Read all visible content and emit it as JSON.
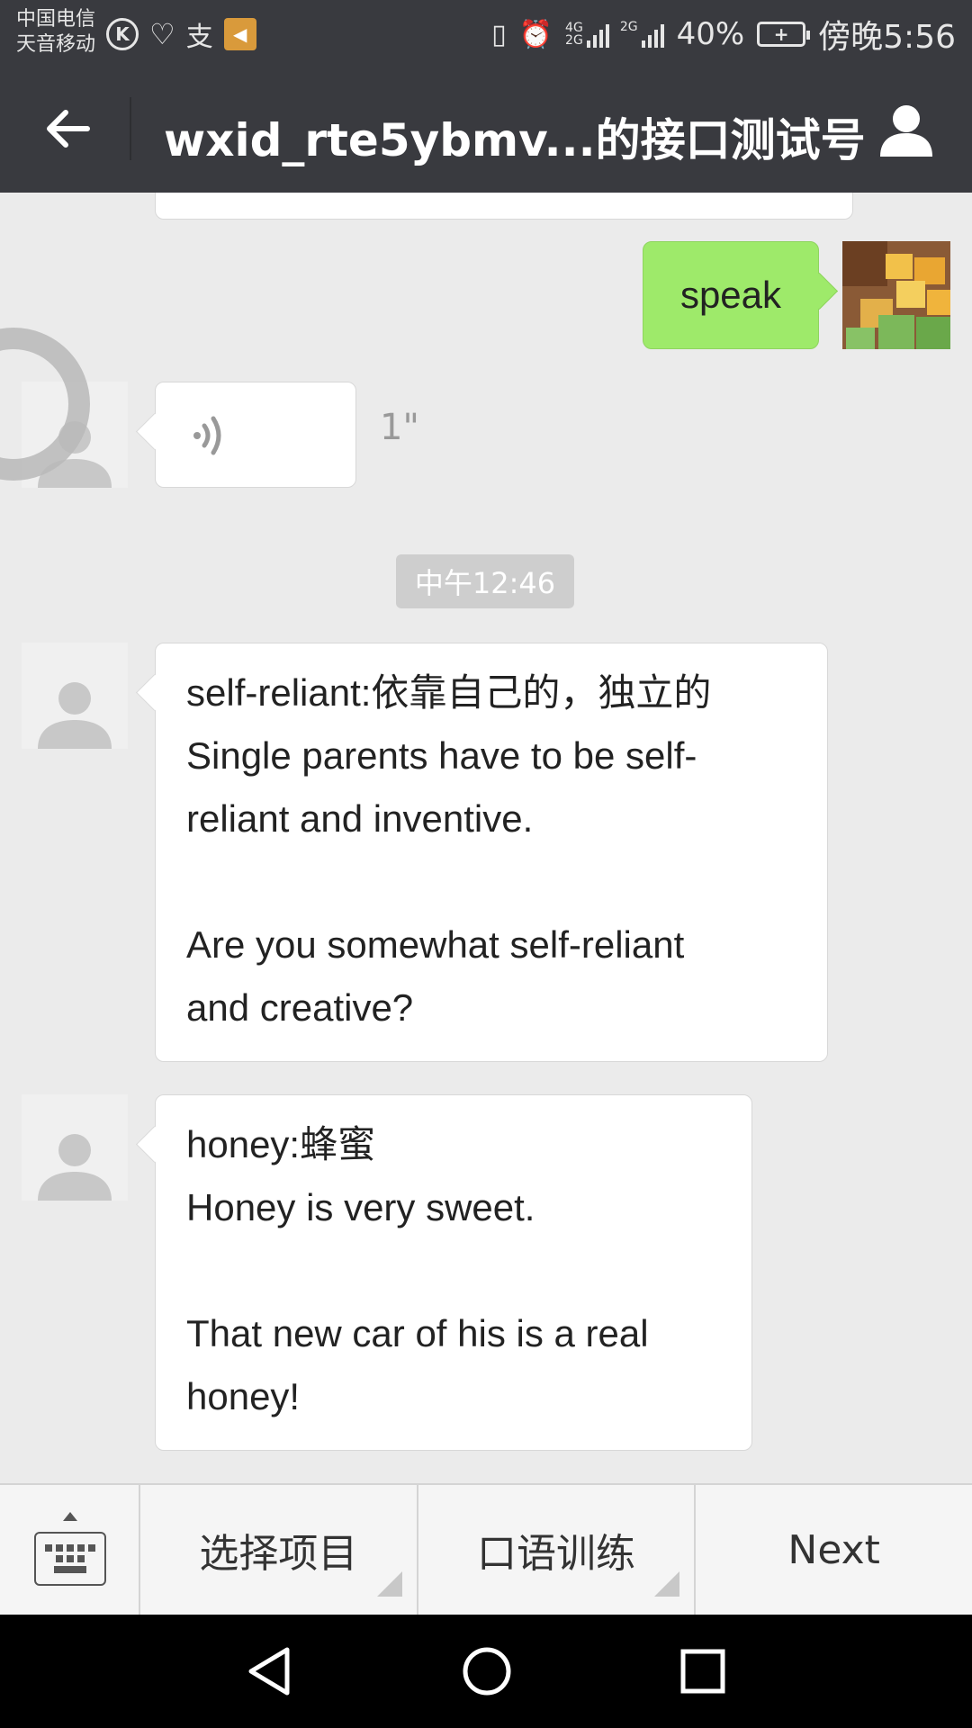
{
  "status_bar": {
    "carrier_line1": "中国电信",
    "carrier_line2": "天音移动",
    "k_badge": "K",
    "pay_label": "支",
    "net_4g": "4G",
    "net_2g": "2G",
    "net_2g_b": "2G",
    "battery_percent": "40%",
    "time": "傍晚5:56",
    "icons": [
      "k-icon",
      "heart-icon",
      "pay-icon",
      "sound-icon",
      "vibrate-icon",
      "alarm-icon",
      "signal-icon",
      "battery-icon"
    ]
  },
  "header": {
    "title": "wxid_rte5ybmv...的接口测试号",
    "back_icon": "arrow-left-icon",
    "profile_icon": "person-icon"
  },
  "chat": {
    "sent": {
      "text": "speak"
    },
    "voice": {
      "duration": "1\""
    },
    "time_separator": "中午12:46",
    "messages": [
      {
        "lines": [
          "self-reliant:依靠自己的，独立的",
          "Single parents have to be self-",
          "reliant and inventive.",
          "",
          "Are you somewhat self-reliant",
          "and creative?"
        ]
      },
      {
        "lines": [
          "honey:蜂蜜",
          "Honey is very sweet.",
          "",
          "That new car of his is a real",
          "honey!"
        ]
      }
    ]
  },
  "bottom_menu": {
    "items": [
      {
        "label": "选择项目",
        "has_submenu": true
      },
      {
        "label": "口语训练",
        "has_submenu": true
      },
      {
        "label": "Next",
        "has_submenu": false
      }
    ]
  },
  "colors": {
    "header_bg": "#393a3f",
    "chat_bg": "#ebebeb",
    "sent_bubble": "#9eea6a",
    "received_bubble": "#ffffff",
    "time_badge": "#cecece"
  }
}
